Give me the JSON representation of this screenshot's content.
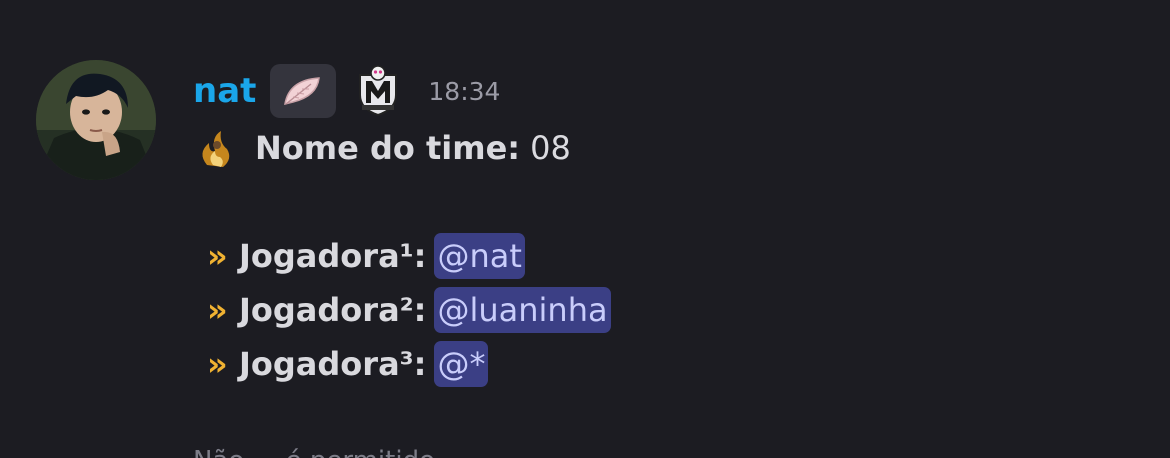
{
  "message": {
    "author": "nat",
    "timestamp": "18:34",
    "badges": [
      "feather-icon",
      "monster-high-icon"
    ],
    "colors": {
      "username": "#1aa6ea",
      "mention_bg": "#3b3f85",
      "mention_text": "#c9cdfb",
      "chevron": "#f0b232"
    },
    "team_label": "Nome do time:",
    "team_value": "08",
    "players": [
      {
        "bullet": "»",
        "label": "Jogadora¹:",
        "mention": "@nat"
      },
      {
        "bullet": "»",
        "label": "Jogadora²:",
        "mention": "@luaninha"
      },
      {
        "bullet": "»",
        "label": "Jogadora³:",
        "mention": "@*"
      }
    ],
    "footer": "Não ... é permitido"
  }
}
